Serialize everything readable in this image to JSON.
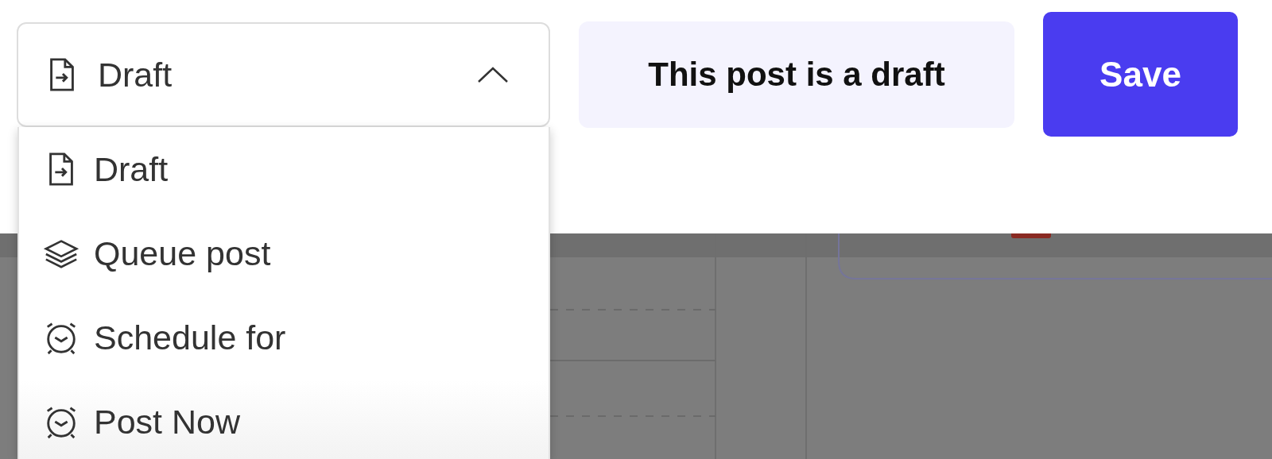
{
  "status_select": {
    "value": "Draft",
    "kind": "doc",
    "expanded": true
  },
  "options": [
    {
      "label": "Draft",
      "kind": "doc",
      "highlighted": false
    },
    {
      "label": "Queue post",
      "kind": "layers",
      "highlighted": false
    },
    {
      "label": "Schedule for",
      "kind": "clock",
      "highlighted": false
    },
    {
      "label": "Post Now",
      "kind": "clock",
      "highlighted": true
    }
  ],
  "status_note": "This post is a draft",
  "save_button": "Save"
}
